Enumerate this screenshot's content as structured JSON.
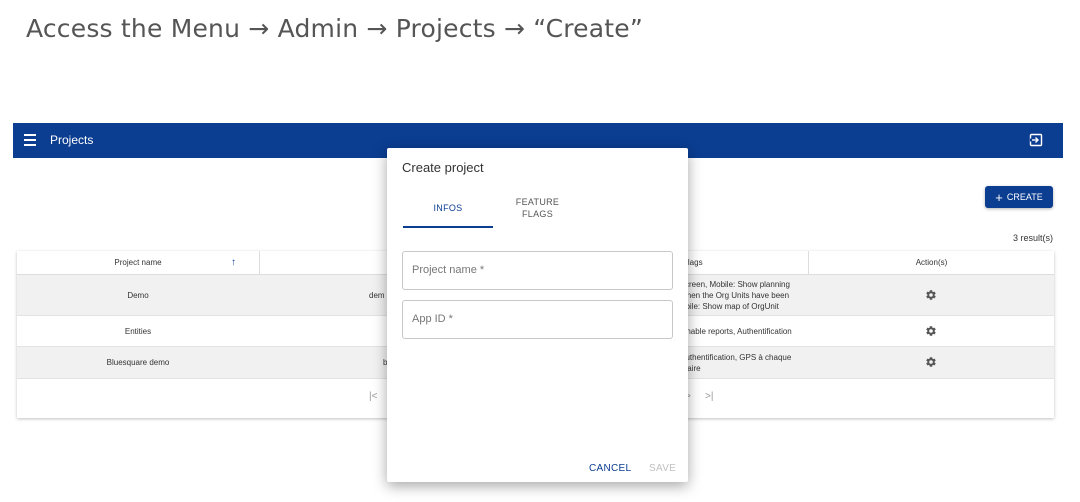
{
  "caption": "Access the Menu → Admin → Projects → “Create”",
  "appbar": {
    "title": "Projects",
    "menu_icon": "hamburger-menu-icon",
    "logout_icon": "logout-icon"
  },
  "toolbar": {
    "create_label": "CREATE",
    "results": "3 result(s)"
  },
  "table": {
    "headers": {
      "name": "Project name",
      "flags": "e flags",
      "actions": "Action(s)"
    },
    "rows": [
      {
        "name": "Demo",
        "app_id": "dem",
        "flags_line1": "screen, Mobile: Show planning",
        "flags_line2": "when the Org Units have been",
        "flags_line3": "obile: Show map of OrgUnit"
      },
      {
        "name": "Entities",
        "app_id": "",
        "flags_line1": "Enable reports, Authentification"
      },
      {
        "name": "Bluesquare demo",
        "app_id": "b",
        "flags_line1": "authentification, GPS à chaque",
        "flags_line2": "ulaire"
      }
    ],
    "pager": {
      "first": "|<",
      "last": ">|",
      "next": ">"
    }
  },
  "dialog": {
    "title": "Create project",
    "tabs": {
      "infos": "INFOS",
      "flags_line1": "FEATURE",
      "flags_line2": "FLAGS"
    },
    "project_name_placeholder": "Project name *",
    "app_id_placeholder": "App ID *",
    "cancel_label": "CANCEL",
    "save_label": "SAVE"
  },
  "colors": {
    "primary": "#0b3d91",
    "disabled": "#c0c0c0"
  }
}
